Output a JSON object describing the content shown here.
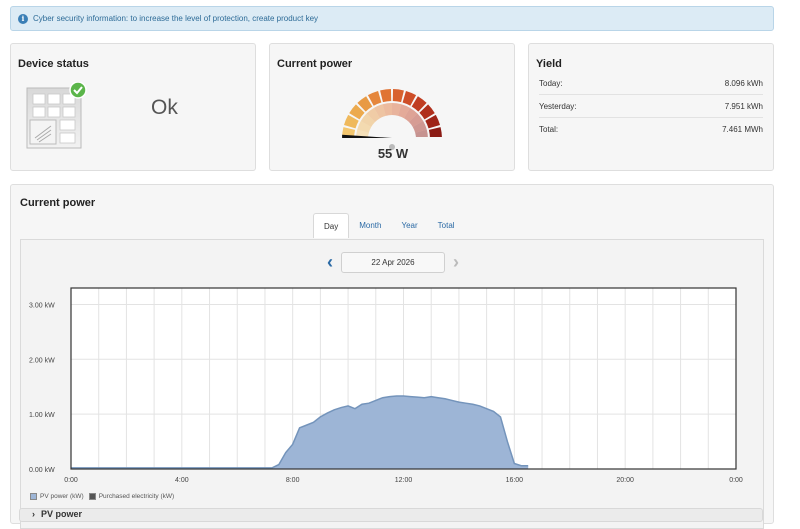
{
  "alert": {
    "text": "Cyber security information: to increase the level of protection, create product key",
    "icon": "info-icon"
  },
  "status_card": {
    "title": "Device status",
    "value": "Ok",
    "icon": "device-ok-icon"
  },
  "power_card": {
    "title": "Current power",
    "value": "55 W",
    "gauge_fraction": 0.02
  },
  "yield_card": {
    "title": "Yield",
    "rows": [
      {
        "label": "Today:",
        "value": "8.096 kWh"
      },
      {
        "label": "Yesterday:",
        "value": "7.951 kWh"
      },
      {
        "label": "Total:",
        "value": "7.461 MWh"
      }
    ]
  },
  "chart_section": {
    "title": "Current power",
    "tabs": [
      "Day",
      "Month",
      "Year",
      "Total"
    ],
    "active_tab": "Day",
    "date": "22 Apr 2026",
    "legend": [
      "PV power (kW)",
      "Purchased electricity (kW)"
    ],
    "pv_header": "PV power",
    "colors": {
      "pv_fill": "#9db5d6",
      "pv_stroke": "#7494bb",
      "purchased": "#555555"
    }
  },
  "chart_data": {
    "type": "area",
    "title": "",
    "xlabel": "",
    "ylabel": "",
    "ylim": [
      0,
      3.3
    ],
    "xlim_hours": [
      0,
      24
    ],
    "y_ticks": [
      "0.00 kW",
      "1.00 kW",
      "2.00 kW",
      "3.00 kW"
    ],
    "x_ticks": [
      "0:00",
      "4:00",
      "8:00",
      "12:00",
      "16:00",
      "20:00",
      "0:00"
    ],
    "series": [
      {
        "name": "PV power (kW)",
        "x": [
          0,
          7.25,
          7.5,
          7.75,
          8.0,
          8.25,
          8.5,
          8.75,
          9.0,
          9.25,
          9.5,
          9.75,
          10.0,
          10.25,
          10.5,
          10.75,
          11.0,
          11.25,
          11.5,
          11.75,
          12.0,
          12.25,
          12.5,
          12.75,
          13.0,
          13.25,
          13.5,
          13.75,
          14.0,
          14.25,
          14.5,
          14.75,
          15.0,
          15.25,
          15.5,
          15.75,
          16.0,
          16.25,
          16.5
        ],
        "y": [
          0.02,
          0.02,
          0.08,
          0.3,
          0.45,
          0.75,
          0.8,
          0.85,
          0.95,
          1.02,
          1.08,
          1.12,
          1.15,
          1.1,
          1.18,
          1.2,
          1.25,
          1.3,
          1.32,
          1.33,
          1.33,
          1.32,
          1.31,
          1.3,
          1.32,
          1.3,
          1.28,
          1.25,
          1.22,
          1.2,
          1.18,
          1.15,
          1.1,
          1.05,
          0.95,
          0.5,
          0.1,
          0.06,
          0.06
        ]
      },
      {
        "name": "Purchased electricity (kW)",
        "x": [],
        "y": []
      }
    ]
  }
}
